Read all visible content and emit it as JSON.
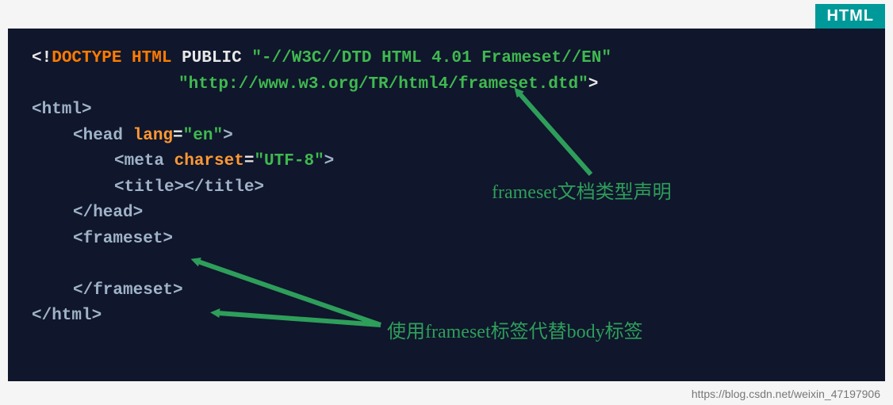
{
  "badge": "HTML",
  "code": {
    "doctype_open": "<!",
    "doctype_kw": "DOCTYPE",
    "html_kw": "HTML",
    "public_kw": "PUBLIC",
    "fpi": "\"-//W3C//DTD HTML 4.01 Frameset//EN\"",
    "dtd_url": "\"http://www.w3.org/TR/html4/frameset.dtd\"",
    "gt": ">",
    "html_open": "<html>",
    "head_open_lt": "<head ",
    "lang_attr": "lang",
    "eq": "=",
    "lang_val": "\"en\"",
    "close_gt": ">",
    "meta_open": "<meta ",
    "charset_attr": "charset",
    "charset_val": "\"UTF-8\"",
    "title_pair": "<title></title>",
    "head_close": "</head>",
    "frameset_open": "<frameset>",
    "frameset_close": "</frameset>",
    "html_close": "</html>"
  },
  "annotations": {
    "doctype_note": "frameset文档类型声明",
    "frameset_note": "使用frameset标签代替body标签"
  },
  "watermark": "https://blog.csdn.net/weixin_47197906",
  "arrow_color": "#2e9e5b"
}
